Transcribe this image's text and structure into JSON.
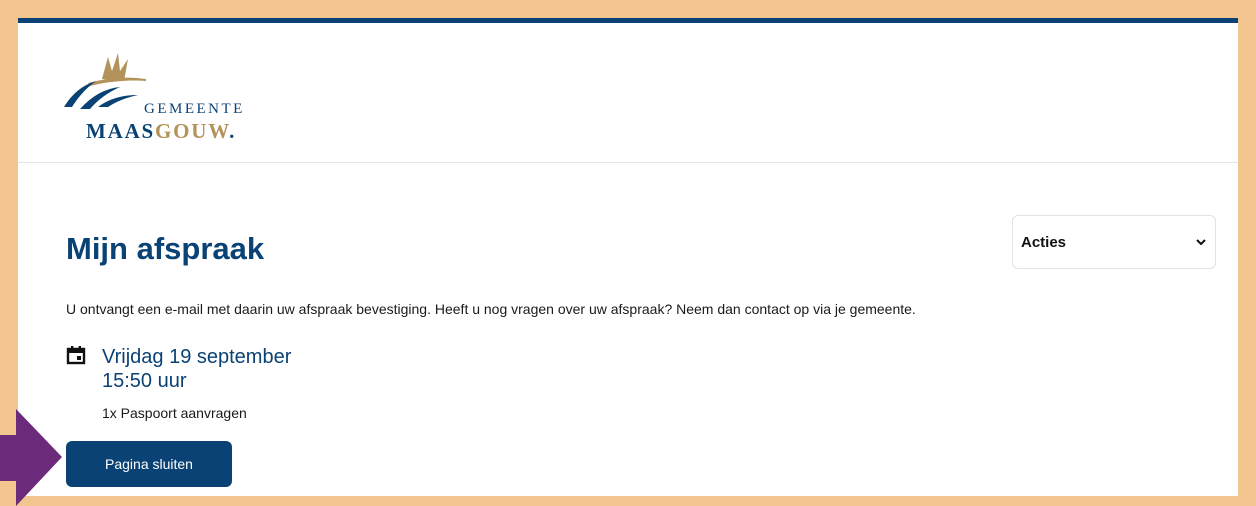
{
  "brand": {
    "gemeente": "GEMEENTE",
    "name_part1": "MAAS",
    "name_part2": "GOUW",
    "name_suffix": ".",
    "colors": {
      "navy": "#0b4275",
      "gold": "#b3935a"
    }
  },
  "page": {
    "title": "Mijn afspraak",
    "intro": "U ontvangt een e-mail met daarin uw afspraak bevestiging. Heeft u nog vragen over uw afspraak? Neem dan contact op via je gemeente."
  },
  "actions_select": {
    "selected": "Acties",
    "icon": "chevron-down-icon"
  },
  "appointment": {
    "icon": "calendar-icon",
    "date": "Vrijdag 19 september",
    "time": "15:50 uur",
    "service": "1x Paspoort aanvragen"
  },
  "close_button": {
    "label": "Pagina sluiten"
  },
  "annotation": {
    "icon": "arrow-right-icon",
    "color": "#6b2a7a"
  },
  "theme": {
    "frame_border": "#f3c68f",
    "accent": "#0b4275"
  }
}
